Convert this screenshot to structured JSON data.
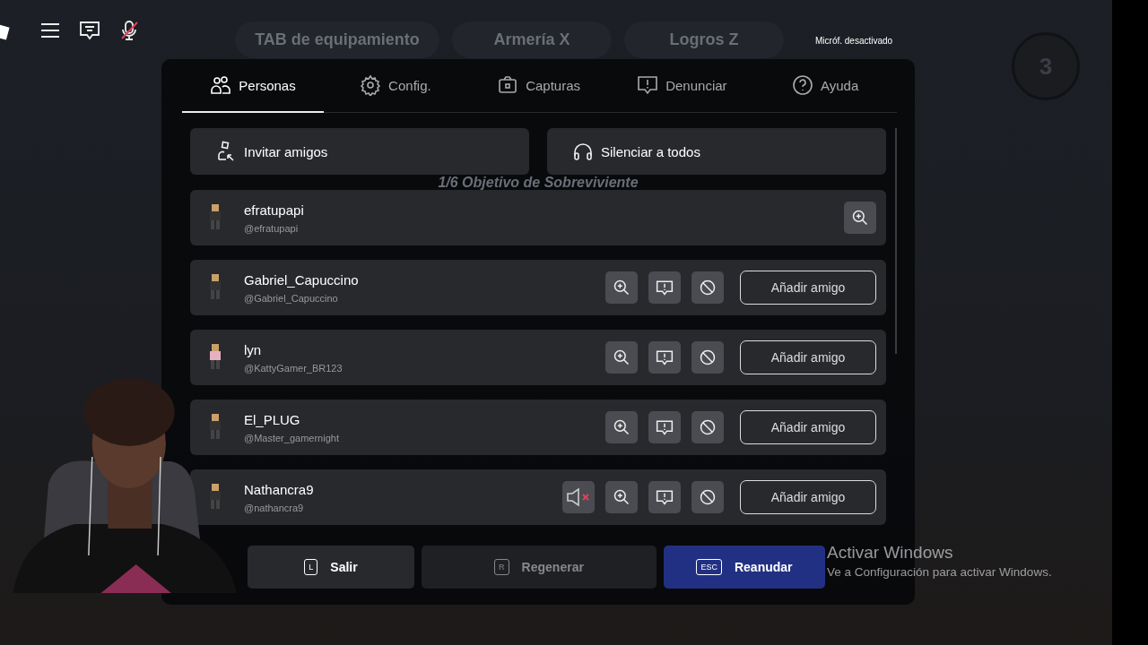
{
  "top_bar": {
    "mic_muted": true,
    "mic_status": "Micróf. desactivado"
  },
  "game_hud": {
    "pills": [
      "TAB de equipamiento",
      "Armería X",
      "Logros Z"
    ],
    "timer": "3",
    "objective": "1/6 Objetivo de Sobreviviente"
  },
  "tabs": [
    {
      "label": "Personas",
      "selected": true
    },
    {
      "label": "Config.",
      "selected": false
    },
    {
      "label": "Capturas",
      "selected": false
    },
    {
      "label": "Denunciar",
      "selected": false
    },
    {
      "label": "Ayuda",
      "selected": false
    }
  ],
  "actions": [
    {
      "label": "Invitar amigos"
    },
    {
      "label": "Silenciar a todos"
    }
  ],
  "players": [
    {
      "kind": "self",
      "display_name": "efratupapi",
      "username": "@efratupapi",
      "muted": false
    },
    {
      "kind": "other",
      "display_name": "Gabriel_Capuccino",
      "username": "@Gabriel_Capuccino",
      "muted": false,
      "add_friend": "Añadir amigo"
    },
    {
      "kind": "other",
      "display_name": "lyn",
      "username": "@KattyGamer_BR123",
      "muted": false,
      "add_friend": "Añadir amigo"
    },
    {
      "kind": "other",
      "display_name": "El_PLUG",
      "username": "@Master_gamernight",
      "muted": false,
      "add_friend": "Añadir amigo"
    },
    {
      "kind": "other",
      "display_name": "Nathancra9",
      "username": "@nathancra9",
      "muted": true,
      "add_friend": "Añadir amigo"
    }
  ],
  "footer": [
    {
      "key": "L",
      "label": "Salir",
      "disabled": false
    },
    {
      "key": "R",
      "label": "Regenerar",
      "disabled": true
    },
    {
      "key": "ESC",
      "label": "Reanudar",
      "disabled": false
    }
  ],
  "watermark": {
    "title": "Activar Windows",
    "text": "Ve a Configuración para activar Windows."
  }
}
